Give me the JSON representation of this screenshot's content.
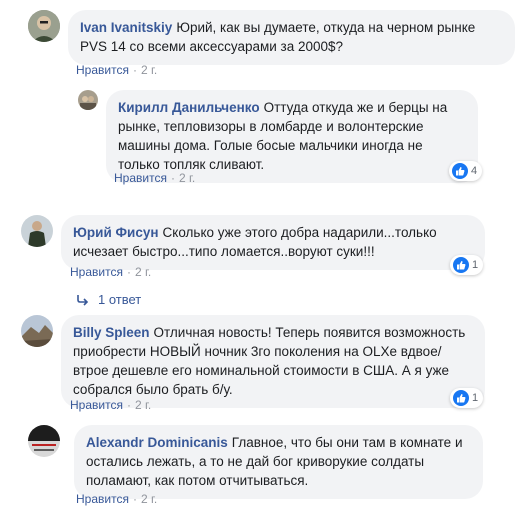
{
  "like_label": "Нравится",
  "comments": [
    {
      "author": "Ivan Ivanitskiy",
      "text": "Юрий, как вы думаете, откуда на черном рынке PVS 14 со всеми аксессуарами за 2000$?",
      "time": "2 г."
    },
    {
      "author": "Кирилл Данильченко",
      "text": "Оттуда откуда же и берцы на рынке, тепловизоры в ломбарде и волонтерские машины дома. Голые босые мальчики иногда не только топляк сливают.",
      "time": "2 г.",
      "reactions": "4"
    },
    {
      "author": "Юрий Фисун",
      "text": "Сколько уже этого добра надарили...только исчезает быстро...типо ломается..воруют суки!!!",
      "time": "2 г.",
      "reactions": "1",
      "replies": "1 ответ"
    },
    {
      "author": "Billy Spleen",
      "text": "Отличная новость! Теперь появится возможность приобрести НОВЫЙ ночник 3го поколения на OLXe вдвое/втрое дешевле его номинальной стоимости в США. А я уже собрался было брать б/у.",
      "time": "2 г.",
      "reactions": "1"
    },
    {
      "author": "Alexandr Dominicanis",
      "text": "Главное, что бы они там в комнате и остались лежать, а то не дай бог криворукие солдаты поламают, как потом отчитываться.",
      "time": "2 г."
    }
  ],
  "colors": {
    "link": "#385898",
    "bubble": "#f2f3f5",
    "like": "#1877f2",
    "meta": "#90949c"
  }
}
